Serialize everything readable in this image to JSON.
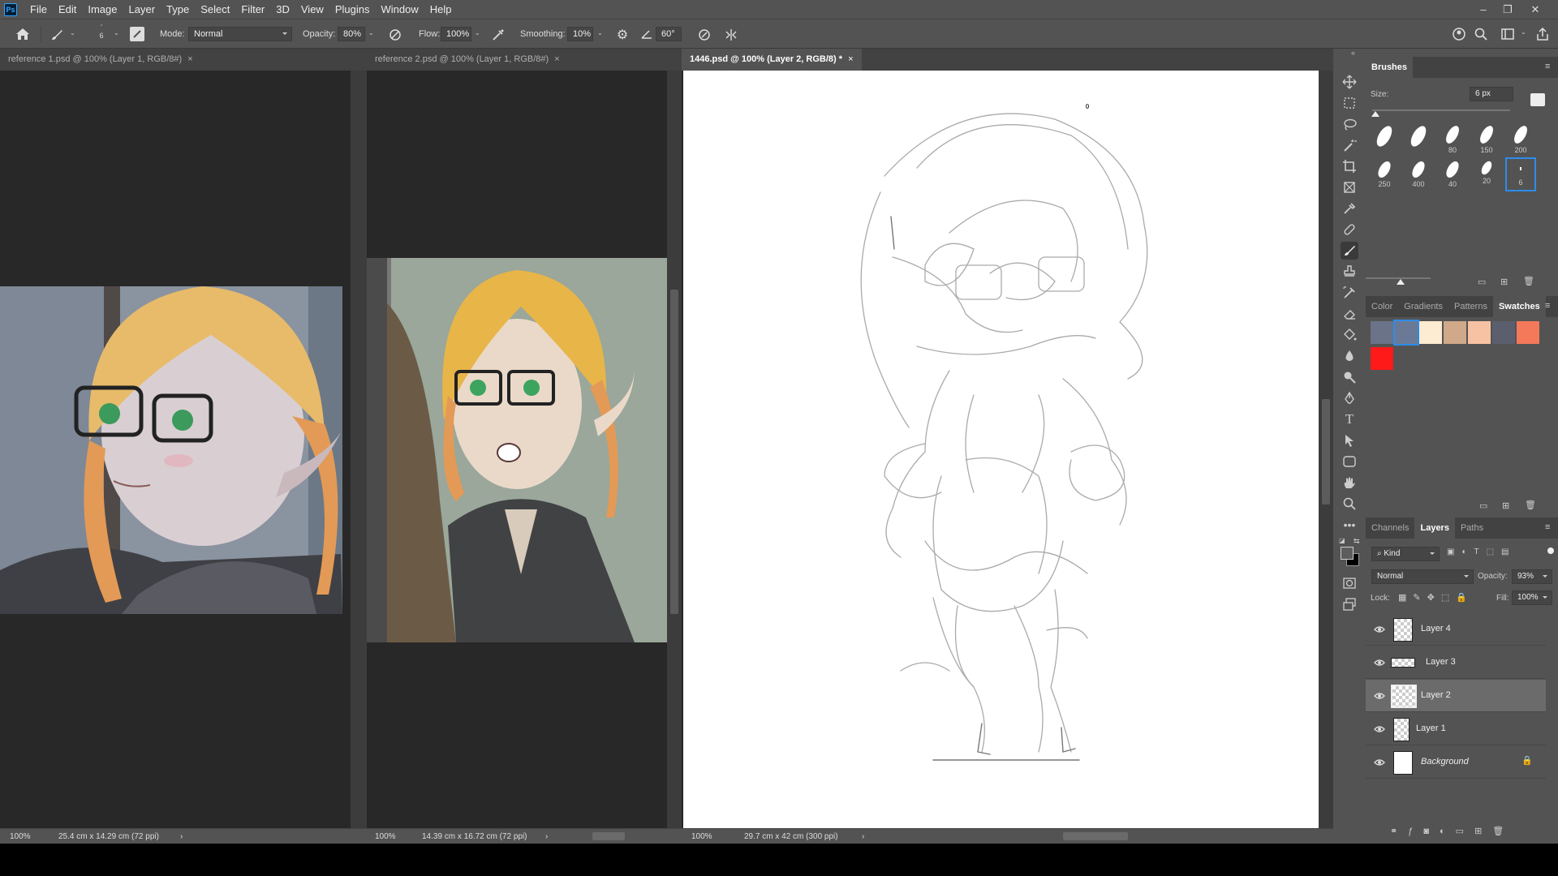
{
  "menu": {
    "logo": "Ps",
    "items": [
      "File",
      "Edit",
      "Image",
      "Layer",
      "Type",
      "Select",
      "Filter",
      "3D",
      "View",
      "Plugins",
      "Window",
      "Help"
    ]
  },
  "window": {
    "minimize": "–",
    "restore": "❐",
    "close": "✕"
  },
  "options": {
    "brush_size": "6",
    "mode_label": "Mode:",
    "mode_value": "Normal",
    "opacity_label": "Opacity:",
    "opacity_value": "80%",
    "flow_label": "Flow:",
    "flow_value": "100%",
    "smoothing_label": "Smoothing:",
    "smoothing_value": "10%",
    "angle_value": "60°"
  },
  "tabs": {
    "doc1": "reference 1.psd @ 100% (Layer 1, RGB/8#)",
    "doc2": "reference 2.psd @ 100% (Layer 1, RGB/8#)",
    "doc3": "1446.psd @ 100% (Layer 2, RGB/8) *",
    "close": "×"
  },
  "status": {
    "doc1_zoom": "100%",
    "doc1_size": "25.4 cm x 14.29 cm (72 ppi)",
    "doc2_zoom": "100%",
    "doc2_size": "14.39 cm x 16.72 cm (72 ppi)",
    "doc3_zoom": "100%",
    "doc3_size": "29.7 cm x 42 cm (300 ppi)",
    "arrow": "›"
  },
  "brushes_panel": {
    "title": "Brushes",
    "size_label": "Size:",
    "size_value": "6 px",
    "presets": [
      "",
      "",
      "80",
      "150",
      "200",
      "250",
      "400",
      "40",
      "20",
      "6"
    ]
  },
  "color_tabs": [
    "Color",
    "Gradients",
    "Patterns",
    "Swatches"
  ],
  "swatches": [
    "#6a7388",
    "#6a7a96",
    "#fdebd2",
    "#cfa98a",
    "#f7c2a4",
    "#5b5e6c",
    "#f4785a",
    "#ff1a1a"
  ],
  "layers_tabs": [
    "Channels",
    "Layers",
    "Paths"
  ],
  "layers_panel": {
    "kind_label": "Kind",
    "blend_mode": "Normal",
    "opacity_label": "Opacity:",
    "opacity_value": "93%",
    "lock_label": "Lock:",
    "fill_label": "Fill:",
    "fill_value": "100%"
  },
  "layers": [
    "Layer 4",
    "Layer 3",
    "Layer 2",
    "Layer 1",
    "Background"
  ],
  "selected_layer": "Layer 2"
}
